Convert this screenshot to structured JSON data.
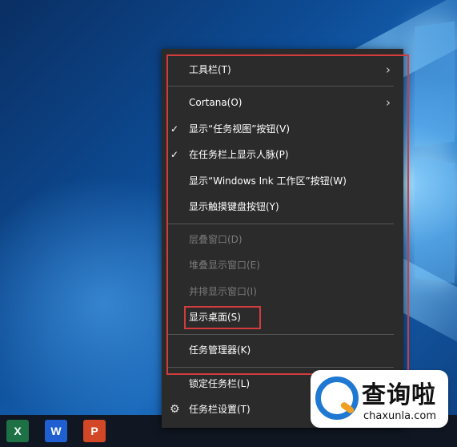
{
  "context_menu": {
    "items": [
      {
        "label": "工具栏(T)",
        "enabled": true,
        "checked": false,
        "submenu": true
      },
      {
        "label": "Cortana(O)",
        "enabled": true,
        "checked": false,
        "submenu": true
      },
      {
        "label": "显示“任务视图”按钮(V)",
        "enabled": true,
        "checked": true,
        "submenu": false
      },
      {
        "label": "在任务栏上显示人脉(P)",
        "enabled": true,
        "checked": true,
        "submenu": false
      },
      {
        "label": "显示“Windows Ink 工作区”按钮(W)",
        "enabled": true,
        "checked": false,
        "submenu": false
      },
      {
        "label": "显示触摸键盘按钮(Y)",
        "enabled": true,
        "checked": false,
        "submenu": false
      },
      {
        "label": "层叠窗口(D)",
        "enabled": false,
        "checked": false,
        "submenu": false
      },
      {
        "label": "堆叠显示窗口(E)",
        "enabled": false,
        "checked": false,
        "submenu": false
      },
      {
        "label": "并排显示窗口(I)",
        "enabled": false,
        "checked": false,
        "submenu": false
      },
      {
        "label": "显示桌面(S)",
        "enabled": true,
        "checked": false,
        "submenu": false,
        "highlighted": true
      },
      {
        "label": "任务管理器(K)",
        "enabled": true,
        "checked": false,
        "submenu": false
      },
      {
        "label": "锁定任务栏(L)",
        "enabled": true,
        "checked": false,
        "submenu": false
      },
      {
        "label": "任务栏设置(T)",
        "enabled": true,
        "checked": false,
        "submenu": false,
        "icon": "gear-icon"
      }
    ],
    "check_glyph": "✓",
    "chevron_glyph": "›",
    "gear_glyph": "⚙"
  },
  "taskbar": {
    "apps": [
      {
        "name": "excel-icon",
        "letter": "X",
        "color": "#1e7145"
      },
      {
        "name": "wps-icon",
        "letter": "W",
        "color": "#1f5fd1"
      },
      {
        "name": "powerpoint-icon",
        "letter": "P",
        "color": "#d24726"
      }
    ]
  },
  "watermark": {
    "title": "查询啦",
    "url": "chaxunla.com"
  },
  "colors": {
    "menu_bg": "#2b2b2b",
    "highlight_border": "#d23c3c",
    "disabled_text": "#7a7a7a"
  }
}
